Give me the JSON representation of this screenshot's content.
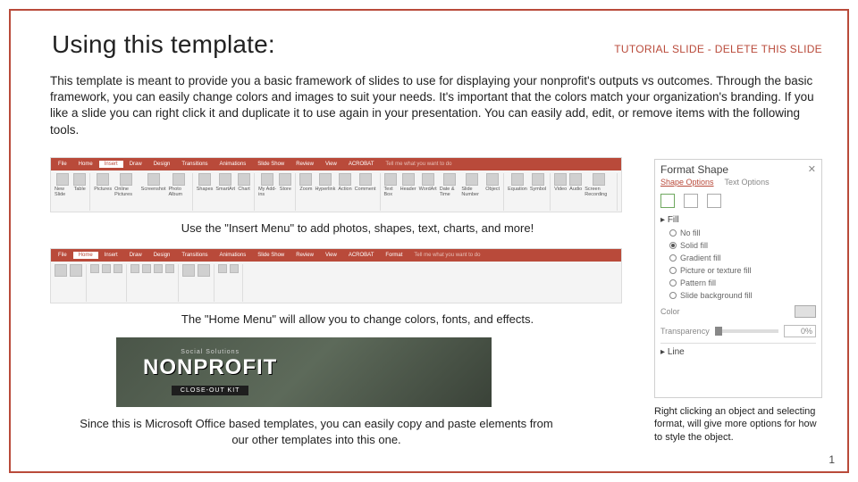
{
  "header": {
    "title": "Using this template:",
    "warning": "TUTORIAL SLIDE - DELETE THIS SLIDE"
  },
  "intro": "This template is meant to provide you a basic framework of slides to use for displaying your nonprofit's outputs vs outcomes. Through the basic framework, you can easily change colors and images to suit your needs. It's important that the colors match your organization's branding. If you like a slide you can right click it and duplicate it to use again in your presentation. You can easily add, edit, or remove items with the following tools.",
  "ribbons": {
    "insert": {
      "tabs": [
        "File",
        "Home",
        "Insert",
        "Draw",
        "Design",
        "Transitions",
        "Animations",
        "Slide Show",
        "Review",
        "View",
        "ACROBAT"
      ],
      "tell": "Tell me what you want to do",
      "groups": [
        [
          "New Slide",
          "Table"
        ],
        [
          "Pictures",
          "Online Pictures",
          "Screenshot",
          "Photo Album"
        ],
        [
          "Shapes",
          "SmartArt",
          "Chart"
        ],
        [
          "My Add-ins",
          "Store"
        ],
        [
          "Zoom",
          "Hyperlink",
          "Action",
          "Comment"
        ],
        [
          "Text Box",
          "Header",
          "WordArt",
          "Date & Time",
          "Slide Number",
          "Object"
        ],
        [
          "Equation",
          "Symbol"
        ],
        [
          "Video",
          "Audio",
          "Screen Recording"
        ]
      ]
    },
    "home": {
      "tabs": [
        "File",
        "Home",
        "Insert",
        "Draw",
        "Design",
        "Transitions",
        "Animations",
        "Slide Show",
        "Review",
        "View",
        "ACROBAT",
        "Format"
      ],
      "tell": "Tell me what you want to do"
    }
  },
  "captions": {
    "c1": "Use the \"Insert Menu\" to add photos, shapes, text, charts, and more!",
    "c2": "The \"Home Menu\" will allow you to change colors, fonts, and effects.",
    "c3": "Since this is Microsoft Office based templates, you can easily copy and paste elements from our other templates into this one.",
    "sidebar": "Right clicking an object and selecting format, will give more options for how to style the object."
  },
  "nonprofit": {
    "top": "Social Solutions",
    "big": "NONPROFIT",
    "sub": "CLOSE-OUT KIT"
  },
  "format_panel": {
    "title": "Format Shape",
    "tabs": {
      "active": "Shape Options",
      "other": "Text Options"
    },
    "section": "Fill",
    "options": [
      "No fill",
      "Solid fill",
      "Gradient fill",
      "Picture or texture fill",
      "Pattern fill",
      "Slide background fill"
    ],
    "color_label": "Color",
    "transp_label": "Transparency",
    "transp_value": "0%",
    "line_label": "Line"
  },
  "slide_number": "1"
}
